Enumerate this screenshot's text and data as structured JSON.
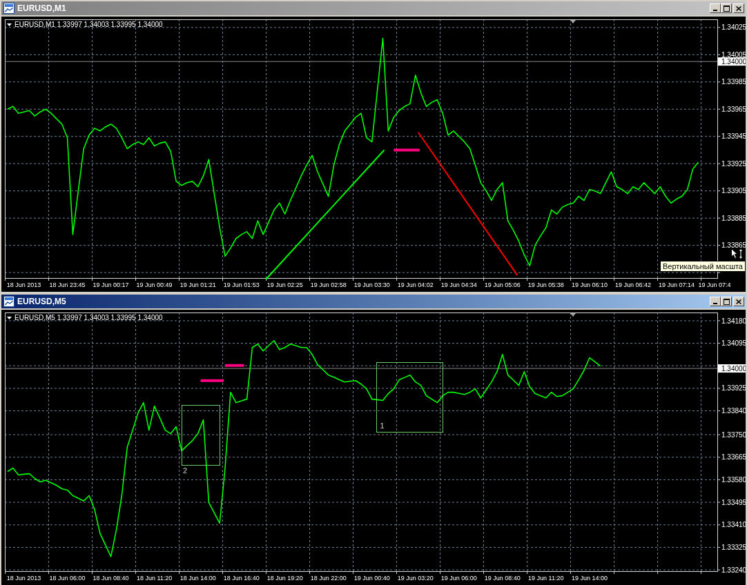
{
  "windows": [
    {
      "title": "EURUSD,M1",
      "active": false,
      "chart": {
        "header": "EURUSD,M1 1.33997 1.34003 1.33995 1.34000",
        "tooltip": "Вертикальный масшта",
        "chart_data": {
          "type": "line",
          "grid": true,
          "categories": [
            null,
            null,
            null,
            "18 Jun 2013",
            null,
            null,
            null,
            null,
            null,
            null,
            null,
            "18 Jun 23:45",
            null,
            null,
            null,
            null,
            null,
            null,
            null,
            "19 Jun 00:17",
            null,
            null,
            null,
            null,
            null,
            null,
            null,
            "19 Jun 00:49",
            null,
            null,
            null,
            null,
            null,
            null,
            null,
            "19 Jun 01:21",
            null,
            null,
            null,
            null,
            null,
            null,
            null,
            "19 Jun 01:53",
            null,
            null,
            null,
            null,
            null,
            null,
            null,
            "19 Jun 02:25",
            null,
            null,
            null,
            null,
            null,
            null,
            null,
            "19 Jun 02:58",
            null,
            null,
            null,
            null,
            null,
            null,
            null,
            "19 Jun 03:30",
            null,
            null,
            null,
            null,
            null,
            null,
            null,
            "19 Jun 04:02",
            null,
            null,
            null,
            null,
            null,
            null,
            null,
            "19 Jun 04:34",
            null,
            null,
            null,
            null,
            null,
            null,
            null,
            "19 Jun 05:06",
            null,
            null,
            null,
            null,
            null,
            null,
            null,
            "19 Jun 05:38",
            null,
            null,
            null,
            null,
            null,
            null,
            null,
            "19 Jun 06:10",
            null,
            null,
            null,
            null,
            null,
            null,
            null,
            "19 Jun 06:42",
            null,
            null,
            null,
            null,
            null,
            null,
            null,
            "19 Jun 07:14",
            null,
            null,
            null,
            null,
            null,
            null,
            "19 Jun 07:4"
          ],
          "values": [
            1.33965,
            1.33967,
            1.33962,
            1.33963,
            1.33964,
            1.3396,
            1.33963,
            1.33965,
            1.33962,
            1.33958,
            1.33954,
            1.33944,
            1.33873,
            1.33905,
            1.33936,
            1.33946,
            1.33951,
            1.33949,
            1.33952,
            1.33954,
            1.33951,
            1.33944,
            1.33936,
            1.33939,
            1.33941,
            1.33939,
            1.33944,
            1.33938,
            1.3394,
            1.33941,
            1.33934,
            1.33912,
            1.33909,
            1.33911,
            1.33912,
            1.33908,
            1.33916,
            1.33928,
            1.33903,
            1.33878,
            1.33857,
            1.33863,
            1.3387,
            1.33873,
            1.33875,
            1.3387,
            1.33883,
            1.33873,
            1.33882,
            1.33891,
            1.33896,
            1.33888,
            1.33898,
            1.33907,
            1.33916,
            1.33924,
            1.33931,
            1.33919,
            1.3391,
            1.33901,
            1.33924,
            1.33939,
            1.33949,
            1.33954,
            1.33959,
            1.33962,
            1.33944,
            1.33941,
            1.33979,
            1.34017,
            1.33949,
            1.33959,
            1.33964,
            1.33967,
            1.33969,
            1.3399,
            1.33977,
            1.33967,
            1.3397,
            1.33972,
            1.33962,
            1.33946,
            1.33949,
            1.33945,
            1.33941,
            1.33936,
            1.33924,
            1.33911,
            1.33905,
            1.33898,
            1.33906,
            1.33911,
            1.33883,
            1.33876,
            1.33868,
            1.33858,
            1.3385,
            1.33865,
            1.33872,
            1.33878,
            1.33891,
            1.33888,
            1.33893,
            1.33895,
            1.33896,
            1.33901,
            1.33898,
            1.33906,
            1.33905,
            1.33903,
            1.33911,
            1.33919,
            1.33908,
            1.33906,
            1.33903,
            1.33908,
            1.33906,
            1.33911,
            1.33907,
            1.33903,
            1.33908,
            1.33901,
            1.33896,
            1.33899,
            1.33901,
            1.33906,
            1.33921,
            1.33926,
            null,
            null,
            null
          ],
          "ylim": [
            1.33841,
            1.34031
          ],
          "yticks": [
            {
              "value": 1.34025,
              "label": "1.34025"
            },
            {
              "value": 1.34005,
              "label": "1.34005"
            },
            {
              "value": 1.33985,
              "label": "1.33985"
            },
            {
              "value": 1.33965,
              "label": "1.33965"
            },
            {
              "value": 1.33945,
              "label": "1.33945"
            },
            {
              "value": 1.33925,
              "label": "1.33925"
            },
            {
              "value": 1.33905,
              "label": "1.33905"
            },
            {
              "value": 1.33885,
              "label": "1.33885"
            },
            {
              "value": 1.33865,
              "label": "1.33865"
            }
          ],
          "ref_lines": [
            {
              "axis": "y",
              "value": 1.34,
              "label": "1.34000"
            }
          ]
        }
      }
    },
    {
      "title": "EURUSD,M5",
      "active": true,
      "chart": {
        "header": "EURUSD,M5 1.33997 1.34003 1.33995 1.34000",
        "chart_data": {
          "type": "line",
          "grid": true,
          "categories": [
            null,
            null,
            null,
            "18 Jun 2013",
            null,
            null,
            null,
            null,
            null,
            null,
            null,
            "18 Jun 06:00",
            null,
            null,
            null,
            null,
            null,
            null,
            null,
            "18 Jun 08:40",
            null,
            null,
            null,
            null,
            null,
            null,
            null,
            "18 Jun 11:20",
            null,
            null,
            null,
            null,
            null,
            null,
            null,
            "18 Jun 14:00",
            null,
            null,
            null,
            null,
            null,
            null,
            null,
            "18 Jun 16:40",
            null,
            null,
            null,
            null,
            null,
            null,
            null,
            "18 Jun 19:20",
            null,
            null,
            null,
            null,
            null,
            null,
            null,
            "18 Jun 22:00",
            null,
            null,
            null,
            null,
            null,
            null,
            null,
            "19 Jun 00:40",
            null,
            null,
            null,
            null,
            null,
            null,
            null,
            "19 Jun 03:20",
            null,
            null,
            null,
            null,
            null,
            null,
            null,
            "19 Jun 06:00",
            null,
            null,
            null,
            null,
            null,
            null,
            null,
            "19 Jun 08:40",
            null,
            null,
            null,
            null,
            null,
            null,
            null,
            "19 Jun 11:20",
            null,
            null,
            null,
            null,
            null,
            null,
            null,
            "19 Jun 14:00",
            null,
            null,
            null,
            null,
            null,
            null,
            null,
            null,
            null,
            null,
            null,
            null,
            null,
            null,
            null,
            null,
            null,
            null,
            null,
            null,
            null,
            null,
            null
          ],
          "values": [
            1.33611,
            1.33624,
            1.33598,
            1.33601,
            1.33603,
            1.33585,
            1.33572,
            1.33578,
            1.33569,
            1.33559,
            1.33546,
            1.33541,
            1.3352,
            1.3351,
            1.335,
            1.3352,
            1.33468,
            1.33378,
            1.33334,
            1.3329,
            1.33391,
            1.3352,
            1.33702,
            1.33767,
            1.33832,
            1.33871,
            1.33767,
            1.33858,
            1.33813,
            1.33767,
            1.33754,
            1.3378,
            1.33689,
            1.33709,
            1.33728,
            1.33754,
            1.33806,
            1.33494,
            1.33455,
            1.33416,
            1.33624,
            1.3391,
            1.33871,
            1.33878,
            1.33884,
            1.34079,
            1.34092,
            1.34066,
            1.34086,
            1.34105,
            1.34071,
            1.34079,
            1.34092,
            1.34086,
            1.34079,
            1.34079,
            1.34053,
            1.34014,
            1.33995,
            1.33975,
            1.33967,
            1.33957,
            1.33949,
            1.33952,
            1.33954,
            1.33941,
            1.33923,
            1.33884,
            1.33882,
            1.33879,
            1.33905,
            1.33923,
            1.33957,
            1.33966,
            1.33975,
            1.33949,
            1.33936,
            1.33897,
            1.33884,
            1.33871,
            1.33897,
            1.3391,
            1.3391,
            1.33906,
            1.33902,
            1.3391,
            1.33923,
            1.33889,
            1.33919,
            1.33949,
            1.33988,
            1.34053,
            1.33975,
            1.33956,
            1.33936,
            1.33988,
            1.33931,
            1.33905,
            1.33897,
            1.33889,
            1.3391,
            1.33894,
            1.33897,
            1.3391,
            1.33923,
            1.33957,
            1.33993,
            1.3404,
            1.34025,
            1.34009,
            null,
            null,
            null,
            null,
            null,
            null,
            null,
            null,
            null,
            null,
            null,
            null,
            null,
            null,
            null,
            null,
            null,
            null,
            null,
            null,
            null
          ],
          "ylim": [
            1.33235,
            1.34211
          ],
          "yticks": [
            {
              "value": 1.3418,
              "label": "1.34180"
            },
            {
              "value": 1.34095,
              "label": "1.34095"
            },
            {
              "value": 1.33925,
              "label": "1.33925"
            },
            {
              "value": 1.3384,
              "label": "1.33840"
            },
            {
              "value": 1.3375,
              "label": "1.33750"
            },
            {
              "value": 1.33665,
              "label": "1.33665"
            },
            {
              "value": 1.3358,
              "label": "1.33580"
            },
            {
              "value": 1.33495,
              "label": "1.33495"
            },
            {
              "value": 1.3341,
              "label": "1.33410"
            },
            {
              "value": 1.33325,
              "label": "1.33325"
            },
            {
              "value": 1.3324,
              "label": "1.33240"
            }
          ],
          "ref_lines": [
            {
              "axis": "y",
              "value": 1.34,
              "label": "1.34000"
            }
          ],
          "annotations": [
            "1",
            "2"
          ]
        }
      }
    }
  ]
}
